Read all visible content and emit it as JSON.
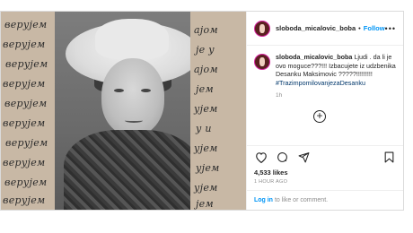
{
  "post": {
    "username": "sloboda_micalovic_boba",
    "follow_label": "Follow",
    "separator": "•",
    "more_label": "•••",
    "caption": {
      "username": "sloboda_micalovic_boba",
      "text": "Ljudi . da li je ovo moguce???!!! Izbacujete iz udzbenika Desanku Maksimovic ?????!!!!!!!!!",
      "hashtag": "#TrazimpomilovanjezaDesanku",
      "time": "1h"
    },
    "likes": "4,533 likes",
    "posted_ago": "1 HOUR AGO",
    "login": {
      "link_label": "Log in",
      "rest": "to like or comment."
    },
    "image": {
      "handwriting_left": [
        "верујем",
        "верујем",
        "верујем",
        "верујем",
        "верујем",
        "верујем",
        "верујем",
        "верујем",
        "верујем",
        "верујем"
      ],
      "handwriting_right": [
        "ајом",
        "је у",
        "ајом",
        "јем",
        "ујем",
        "у и",
        "ујем",
        "ујем",
        "ујем",
        "јем"
      ]
    }
  },
  "icons": {
    "more": "more-icon",
    "heart": "heart-icon",
    "comment": "comment-icon",
    "share": "share-icon",
    "save": "bookmark-icon",
    "add": "plus-circle-icon"
  },
  "colors": {
    "accent": "#0095f6",
    "hashtag": "#00376b",
    "border": "#dbdbdb",
    "muted": "#8e8e8e"
  }
}
